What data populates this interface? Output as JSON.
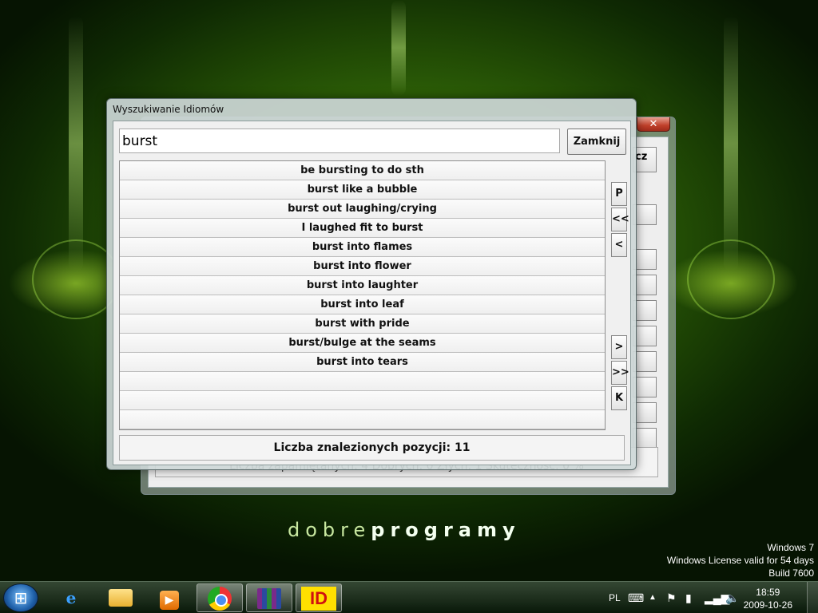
{
  "background_dialog": {
    "close_symbol": "✕",
    "button_partial_label": "cz",
    "status_partial": "Liczba zapamiętanych: 4   Dobrych: 0   Złych: 1   Skuteczność: 0 %"
  },
  "dialog": {
    "title": "Wyszukiwanie Idiomów",
    "search_value": "burst",
    "close_label": "Zamknij",
    "results": [
      "be bursting to do sth",
      "burst like a bubble",
      "burst out laughing/crying",
      "I laughed fit to burst",
      "burst into flames",
      "burst into flower",
      "burst into laughter",
      "burst into leaf",
      "burst with pride",
      "burst/bulge at the seams",
      "burst into tears",
      "",
      "",
      ""
    ],
    "nav": {
      "p": "P",
      "first": "<<",
      "prev": "<",
      "next": ">",
      "last": ">>",
      "k": "K"
    },
    "count_label": "Liczba znalezionych pozycji: 11"
  },
  "desktop": {
    "brand_a": "dobre",
    "brand_b": "programy",
    "windows_line1": "Windows 7",
    "windows_line2": "Windows License valid for 54 days",
    "windows_line3": "Build 7600"
  },
  "taskbar": {
    "language": "PL",
    "time": "18:59",
    "date": "2009-10-26",
    "id_app_label": "ID"
  },
  "colors": {
    "accent_green": "#4f8a0a",
    "id_yellow": "#ffe000",
    "id_red": "#d01010"
  }
}
